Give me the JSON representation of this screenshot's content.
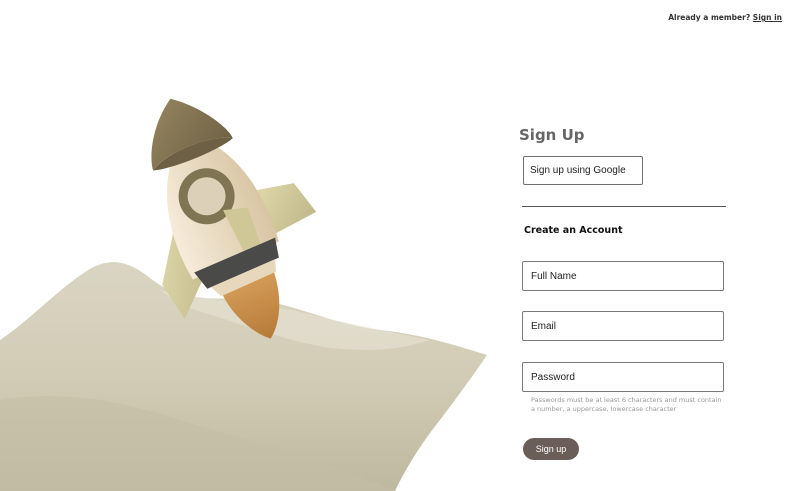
{
  "header": {
    "prompt_text": "Already a  member?",
    "signin_link": "Sign in"
  },
  "form": {
    "title": "Sign Up",
    "google_button": "Sign up using Google",
    "subtitle": "Create an Account",
    "full_name_placeholder": "Full Name",
    "email_placeholder": "Email",
    "password_placeholder": "Password",
    "password_hint": "Passwords must be at least 6 characters and must contain a number, a uppercase, lowercase character",
    "submit_label": "Sign up"
  },
  "colors": {
    "accent": "#6b5e58",
    "sand": "#d8d3bf",
    "rocket_cream": "#efe2cb",
    "rocket_olive": "#8a7a55"
  }
}
